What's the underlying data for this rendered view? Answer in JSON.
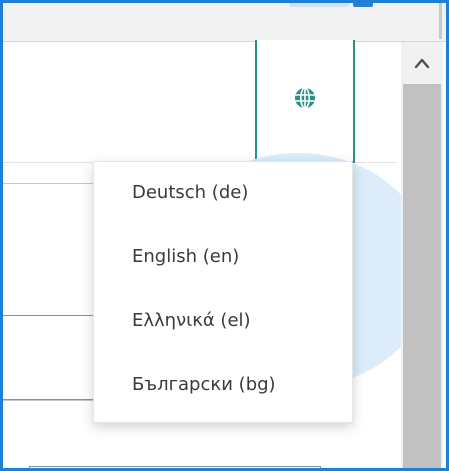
{
  "icons": {
    "language": "globe-icon",
    "scroll_up": "chevron-up-icon"
  },
  "colors": {
    "frame": "#1e7fd6",
    "accent": "#2a8f87",
    "text": "#3a3a3a"
  },
  "language_menu": {
    "options": [
      {
        "label": "Deutsch (de)"
      },
      {
        "label": "English (en)"
      },
      {
        "label": "Ελληνικά (el)"
      },
      {
        "label": "Български (bg)"
      }
    ]
  }
}
